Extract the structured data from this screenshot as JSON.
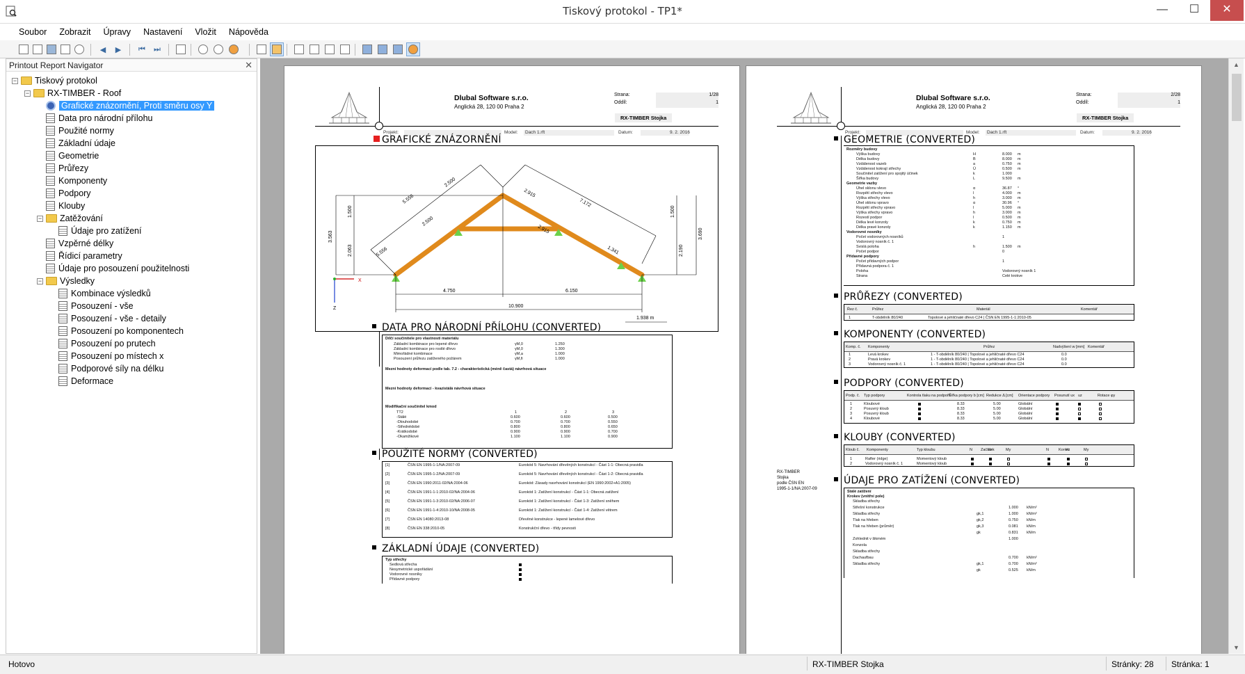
{
  "window": {
    "title": "Tiskový protokol - TP1*",
    "minimize": "—",
    "maximize": "☐",
    "close": "✕"
  },
  "menu": [
    "Soubor",
    "Zobrazit",
    "Úpravy",
    "Nastavení",
    "Vložit",
    "Nápověda"
  ],
  "navigator": {
    "title": "Printout Report Navigator",
    "close": "✕",
    "items": [
      {
        "label": "Tiskový protokol",
        "level": 0,
        "type": "folder",
        "expanded": true
      },
      {
        "label": "RX-TIMBER - Roof",
        "level": 1,
        "type": "folder",
        "expanded": true
      },
      {
        "label": "Grafické znázornění, Proti směru osy Y",
        "level": 2,
        "type": "eye",
        "selected": true
      },
      {
        "label": "Data pro národní přílohu",
        "level": 2,
        "type": "page"
      },
      {
        "label": "Použité normy",
        "level": 2,
        "type": "page"
      },
      {
        "label": "Základní údaje",
        "level": 2,
        "type": "page"
      },
      {
        "label": "Geometrie",
        "level": 2,
        "type": "page"
      },
      {
        "label": "Průřezy",
        "level": 2,
        "type": "page"
      },
      {
        "label": "Komponenty",
        "level": 2,
        "type": "page"
      },
      {
        "label": "Podpory",
        "level": 2,
        "type": "page"
      },
      {
        "label": "Klouby",
        "level": 2,
        "type": "page"
      },
      {
        "label": "Zatěžování",
        "level": 2,
        "type": "folder",
        "expanded": true
      },
      {
        "label": "Údaje pro zatížení",
        "level": 3,
        "type": "page"
      },
      {
        "label": "Vzpěrné délky",
        "level": 2,
        "type": "page"
      },
      {
        "label": "Řídicí parametry",
        "level": 2,
        "type": "page"
      },
      {
        "label": "Údaje pro posouzení použitelnosti",
        "level": 2,
        "type": "page"
      },
      {
        "label": "Výsledky",
        "level": 2,
        "type": "folder",
        "expanded": true
      },
      {
        "label": "Kombinace výsledků",
        "level": 3,
        "type": "page"
      },
      {
        "label": "Posouzení - vše",
        "level": 3,
        "type": "page"
      },
      {
        "label": "Posouzení - vše - detaily",
        "level": 3,
        "type": "page"
      },
      {
        "label": "Posouzení po komponentech",
        "level": 3,
        "type": "page"
      },
      {
        "label": "Posouzení po prutech",
        "level": 3,
        "type": "page"
      },
      {
        "label": "Posouzení po místech x",
        "level": 3,
        "type": "page"
      },
      {
        "label": "Podporové síly na délku",
        "level": 3,
        "type": "page"
      },
      {
        "label": "Deformace",
        "level": 3,
        "type": "page"
      }
    ]
  },
  "status": {
    "left": "Hotovo",
    "center": "RX-TIMBER Stojka",
    "pages": "Stránky: 28",
    "page": "Stránka: 1"
  },
  "pages": [
    {
      "company": "Dlubal Software s.r.o.",
      "address": "Anglická 28, 120 00 Praha 2",
      "strana_label": "Strana:",
      "strana": "1/28",
      "oddil_label": "Oddíl:",
      "oddil": "1",
      "product": "RX-TIMBER Stojka",
      "projekt_label": "Projekt:",
      "model_label": "Model:",
      "model": "Dach 1.rft",
      "datum_label": "Datum:",
      "datum": "9. 2. 2016"
    },
    {
      "company": "Dlubal Software s.r.o.",
      "address": "Anglická 28, 120 00 Praha 2",
      "strana_label": "Strana:",
      "strana": "2/28",
      "oddil_label": "Oddíl:",
      "oddil": "1",
      "product": "RX-TIMBER Stojka",
      "projekt_label": "Projekt:",
      "model_label": "Model:",
      "model": "Dach 1.rft",
      "datum_label": "Datum:",
      "datum": "9. 2. 2016"
    }
  ],
  "sections_p1": [
    "GRAFICKÉ ZNÁZORNĚNÍ",
    "DATA PRO NÁRODNÍ PŘÍLOHU (CONVERTED)",
    "POUŽITÉ NORMY (CONVERTED)",
    "ZÁKLADNÍ ÚDAJE (CONVERTED)"
  ],
  "sections_p2": [
    "GEOMETRIE (CONVERTED)",
    "PRŮŘEZY (CONVERTED)",
    "KOMPONENTY (CONVERTED)",
    "PODPORY (CONVERTED)",
    "KLOUBY (CONVERTED)",
    "ÚDAJE PRO ZATÍŽENÍ (CONVERTED)"
  ],
  "drawing": {
    "dims": [
      "5.556",
      "2.500",
      "2.915",
      "7.172",
      "2.500",
      "2.915",
      "5.556",
      "1.341",
      "3.563",
      "1.500",
      "2.063",
      "1.500",
      "3.690",
      "2.190",
      "4.750",
      "6.150",
      "10.900",
      "1.938 m"
    ],
    "axes": {
      "x": "X",
      "z": "Z"
    }
  },
  "side_note": {
    "line1": "RX-TIMBER",
    "line2": "Stojka",
    "line3": "podle ČSN EN",
    "line4": "1995-1-1/NA:2007-09"
  },
  "nat_annex": {
    "h1": "Dílčí součinitele pro vlastnosti materiálu",
    "rows": [
      [
        "Základní kombinace pro lepené dřevo",
        "γM,0",
        "1.250"
      ],
      [
        "Základní kombinace pro rostlé dřevo",
        "γM,0",
        "1.300"
      ],
      [
        "Mimořádné kombinace",
        "γM,a",
        "1.000"
      ],
      [
        "Posouzení průřezu zatíženého požárem",
        "γM,fi",
        "1.000"
      ]
    ],
    "h2": "Mezní hodnoty deformací podle tab. 7.2 - charakteristická (méně častá) návrhová situace",
    "h3": "Mezní hodnoty deformací - kvazistálá návrhová situace",
    "h4": "Modifikační součinitel kmod",
    "kmod_head": [
      "TT2",
      "1",
      "2",
      "3"
    ],
    "kmod": [
      [
        "-Stálé",
        "0.600",
        "0.600",
        "0.500"
      ],
      [
        "-Dlouhodobé",
        "0.700",
        "0.700",
        "0.550"
      ],
      [
        "-Střednědobé",
        "0.800",
        "0.800",
        "0.650"
      ],
      [
        "-Krátkodobé",
        "0.900",
        "0.900",
        "0.700"
      ],
      [
        "-Okamžikové",
        "1.100",
        "1.100",
        "0.900"
      ]
    ]
  },
  "norms": [
    [
      "[1]",
      "ČSN EN 1995-1-1/NA:2007-09",
      "Eurokód 5: Navrhování dřevěných konstrukcí - Část 1-1: Obecná pravidla"
    ],
    [
      "[2]",
      "ČSN EN 1995-1-2/NA:2007-09",
      "Eurokód 5: Navrhování dřevěných konstrukcí - Část 1-2: Obecná pravidla"
    ],
    [
      "[3]",
      "ČSN EN 1990:2011-02/NA:2004-06",
      "Eurokód: Zásady navrhování konstrukcí (EN 1990:2002+A1:2005)"
    ],
    [
      "[4]",
      "ČSN EN 1991-1-1:2010-02/NA:2004-06",
      "Eurokód 1: Zatížení konstrukcí - Část 1-1: Obecná zatížení"
    ],
    [
      "[5]",
      "ČSN EN 1991-1-3:2010-02/NA:2006-07",
      "Eurokód 1: Zatížení konstrukcí - Část 1-3: Zatížení sněhem"
    ],
    [
      "[6]",
      "ČSN EN 1991-1-4:2010-10/NA:2008-05",
      "Eurokód 1: Zatížení konstrukcí - Část 1-4: Zatížení větrem"
    ],
    [
      "[7]",
      "ČSN EN 14080:2013-08",
      "Dřevěné konstrukce - lepené lamelové dřevo"
    ],
    [
      "[8]",
      "ČSN EN 338:2010-05",
      "Konstrukční dřevo - třídy pevnosti"
    ]
  ],
  "basic": {
    "h": "Typ střechy",
    "rows": [
      "Sedlová střecha",
      "Nesymetrické uspořádání",
      "Vodorovné nosníky",
      "Přídavné podpory"
    ]
  },
  "geometry": {
    "groups": [
      {
        "h": "Rozměry budovy",
        "rows": [
          [
            "Výška budovy",
            "H",
            "8.000",
            "m"
          ],
          [
            "Délka budovy",
            "B",
            "8.000",
            "m"
          ],
          [
            "Vzdálenost vazeb",
            "a",
            "0.750",
            "m"
          ],
          [
            "Vzdálenost kokrají střechy",
            "Ü",
            "0.500",
            "m"
          ],
          [
            "Součinitel zatížení pro spojitý účinek",
            "k",
            "1.000",
            ""
          ],
          [
            "Šířka budovy",
            "L",
            "9.500",
            "m"
          ]
        ]
      },
      {
        "h": "Geometrie vazby",
        "rows": [
          [
            "Úhel sklonu vlevo",
            "α",
            "36.87",
            "°"
          ],
          [
            "Rozpětí střechy vlevo",
            "l",
            "4.000",
            "m"
          ],
          [
            "Výška střechy vlevo",
            "h",
            "3.000",
            "m"
          ],
          [
            "Úhel sklonu vpravo",
            "α",
            "30.96",
            "°"
          ],
          [
            "Rozpětí střechy vpravo",
            "l",
            "5.000",
            "m"
          ],
          [
            "Výška střechy vpravo",
            "h",
            "3.000",
            "m"
          ],
          [
            "Rozestí podpor",
            "l",
            "0.500",
            "m"
          ],
          [
            "Délka levé konzoly",
            "k",
            "0.750",
            "m"
          ],
          [
            "Délka pravé konzoly",
            "k",
            "1.150",
            "m"
          ]
        ]
      },
      {
        "h": "Vodorovné nosníky",
        "rows": [
          [
            "Počet vodorovných nosníků",
            "",
            "1",
            ""
          ],
          [
            "Vodorovný nosník č. 1",
            "",
            "",
            ""
          ],
          [
            "Svislá poloha",
            "h",
            "1.500",
            "m"
          ],
          [
            "Počet podpor",
            "",
            "0",
            ""
          ]
        ]
      },
      {
        "h": "Přídavné podpory",
        "rows": [
          [
            "Počet přídavných podpor",
            "",
            "1",
            ""
          ],
          [
            "Přídavná podpora č. 1",
            "",
            "",
            ""
          ],
          [
            "Poloha",
            "",
            "Vodorovný nosník 1",
            ""
          ],
          [
            "Strana",
            "",
            "Celé krokve",
            ""
          ]
        ]
      }
    ]
  },
  "sections_table": {
    "head": [
      "Řez č.",
      "Průřez",
      "Materiál",
      "Komentář"
    ],
    "rows": [
      [
        "1",
        "T-obdélník 80/240",
        "Topolové a jehličnaté dřevo C24 | ČSN EN 1995-1-1:2010-05",
        ""
      ]
    ]
  },
  "components_table": {
    "head": [
      "Komp. č.",
      "Komponenty",
      "Průřez",
      "Nadvýšení w [mm]",
      "Komentář"
    ],
    "rows": [
      [
        "1",
        "Levá krokev",
        "1 - T-obdélník 80/240 | Topolové a jehličnaté dřevo C24",
        "0.0",
        ""
      ],
      [
        "2",
        "Pravá krokev",
        "1 - T-obdélník 80/240 | Topolové a jehličnaté dřevo C24",
        "0.0",
        ""
      ],
      [
        "3",
        "Vodorovný nosník č. 1",
        "1 - T-obdélník 80/240 | Topolové a jehličnaté dřevo C24",
        "0.0",
        ""
      ]
    ]
  },
  "supports_table": {
    "head": [
      "Podp. č.",
      "Typ podpory",
      "Kontrola tlaku na podpoře",
      "Šířka podpory b [cm]",
      "Redukce Δ [cm]",
      "Orientace podpory",
      "Posunutí ux",
      "uz",
      "Rotace φy"
    ],
    "rows": [
      [
        "1",
        "Kloubové",
        "8.33",
        "5.00",
        "Globální"
      ],
      [
        "2",
        "Posuvný kloub",
        "8.33",
        "5.00",
        "Globální"
      ],
      [
        "3",
        "Posuvný kloub",
        "8.33",
        "5.00",
        "Globální"
      ],
      [
        "4",
        "Kloubové",
        "8.33",
        "5.00",
        "Globální"
      ]
    ]
  },
  "hinges_table": {
    "head": [
      "Kloub č.",
      "Komponenty",
      "Typ kloubu",
      "Začátek",
      "N",
      "Vz",
      "My",
      "Konec",
      "N",
      "Vz",
      "My"
    ],
    "rows": [
      [
        "1",
        "Rafter (ridge)",
        "Momentový kloub"
      ],
      [
        "2",
        "Vodorovný nosník č. 1",
        "Momentový kloub"
      ]
    ]
  },
  "loads": {
    "h1": "Stálé zatížení",
    "h2": "Krokev (vnitřní pole)",
    "rows": [
      [
        "Skladba střechy",
        "",
        "",
        ""
      ],
      [
        "Střešní konstrukce",
        "",
        "1.000",
        "kN/m²"
      ],
      [
        "Skladba střechy",
        "gk,1",
        "1.000",
        "kN/m²"
      ],
      [
        "Tlak na hřeben",
        "gk,2",
        "0.750",
        "kN/m"
      ],
      [
        "Tlak na hřeben (průměr)",
        "gk,3",
        "0.081",
        "kN/m"
      ],
      [
        "",
        "gk",
        "0.831",
        "kN/m"
      ],
      [
        "Zohlednit v šikmém",
        "",
        "1.000",
        ""
      ],
      [
        "Konzola",
        "",
        "",
        ""
      ],
      [
        "Skladba střechy",
        "",
        "",
        ""
      ],
      [
        "Dachaufbau",
        "",
        "0.700",
        "kN/m²"
      ],
      [
        "Skladba střechy",
        "gk,1",
        "0.700",
        "kN/m²"
      ],
      [
        "",
        "gk",
        "0.525",
        "kN/m"
      ]
    ]
  }
}
